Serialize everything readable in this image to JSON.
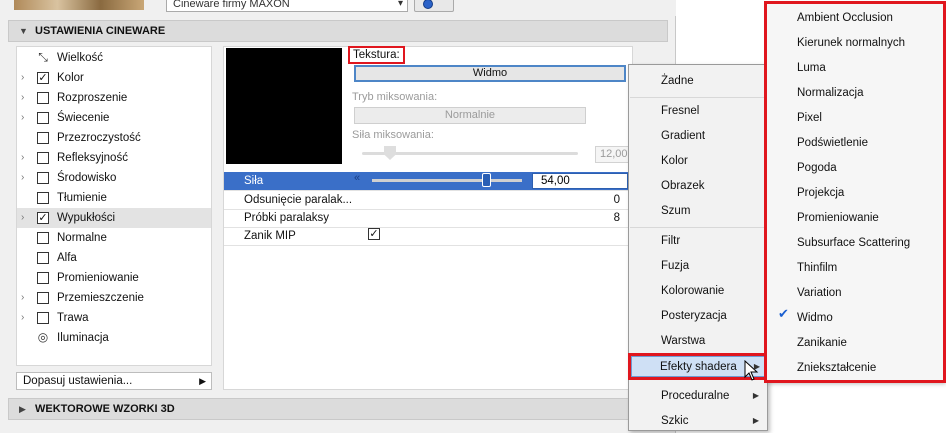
{
  "top": {
    "engine_value": "Cineware firmy MAXON"
  },
  "sections": {
    "cineware": "USTAWIENIA CINEWARE",
    "vector": "WEKTOROWE WZORKI 3D"
  },
  "channels": [
    {
      "label": "Wielkość",
      "kind": "icon",
      "checked": false,
      "arrow": false
    },
    {
      "label": "Kolor",
      "kind": "checkbox",
      "checked": true,
      "arrow": true
    },
    {
      "label": "Rozproszenie",
      "kind": "checkbox",
      "checked": false,
      "arrow": true
    },
    {
      "label": "Świecenie",
      "kind": "checkbox",
      "checked": false,
      "arrow": true
    },
    {
      "label": "Przezroczystość",
      "kind": "checkbox",
      "checked": false,
      "arrow": false
    },
    {
      "label": "Refleksyjność",
      "kind": "checkbox",
      "checked": false,
      "arrow": true
    },
    {
      "label": "Środowisko",
      "kind": "checkbox",
      "checked": false,
      "arrow": true
    },
    {
      "label": "Tłumienie",
      "kind": "checkbox",
      "checked": false,
      "arrow": false
    },
    {
      "label": "Wypukłości",
      "kind": "checkbox",
      "checked": true,
      "arrow": true,
      "selected": true
    },
    {
      "label": "Normalne",
      "kind": "checkbox",
      "checked": false,
      "arrow": false
    },
    {
      "label": "Alfa",
      "kind": "checkbox",
      "checked": false,
      "arrow": false
    },
    {
      "label": "Promieniowanie",
      "kind": "checkbox",
      "checked": false,
      "arrow": false
    },
    {
      "label": "Przemieszczenie",
      "kind": "checkbox",
      "checked": false,
      "arrow": true
    },
    {
      "label": "Trawa",
      "kind": "checkbox",
      "checked": false,
      "arrow": true
    },
    {
      "label": "Iluminacja",
      "kind": "icon",
      "checked": false,
      "arrow": false
    }
  ],
  "adjust_label": "Dopasuj ustawienia...",
  "texture": {
    "label": "Tekstura:",
    "value": "Widmo",
    "blend_mode_label": "Tryb miksowania:",
    "blend_mode_value": "Normalnie",
    "blend_strength_label": "Siła miksowania:",
    "blend_strength_value": "12,00"
  },
  "properties": [
    {
      "label": "Siła",
      "value": "54,00",
      "selected": true
    },
    {
      "label": "Odsunięcie paralak...",
      "value": "0"
    },
    {
      "label": "Próbki paralaksy",
      "value": "8"
    },
    {
      "label": "Zanik MIP",
      "value": "",
      "checkbox": true
    }
  ],
  "menu_main": [
    {
      "label": "Żadne",
      "sep_after": true
    },
    {
      "label": "Fresnel"
    },
    {
      "label": "Gradient"
    },
    {
      "label": "Kolor"
    },
    {
      "label": "Obrazek"
    },
    {
      "label": "Szum",
      "sep_after": true
    },
    {
      "label": "Filtr"
    },
    {
      "label": "Fuzja"
    },
    {
      "label": "Kolorowanie"
    },
    {
      "label": "Posteryzacja"
    },
    {
      "label": "Warstwa",
      "sep_after": true
    },
    {
      "label": "Efekty shadera",
      "submenu": true,
      "highlighted": true
    },
    {
      "label": "Proceduralne",
      "submenu": true
    },
    {
      "label": "Szkic",
      "submenu": true
    }
  ],
  "menu_shader": [
    {
      "label": "Ambient Occlusion"
    },
    {
      "label": "Kierunek normalnych"
    },
    {
      "label": "Luma"
    },
    {
      "label": "Normalizacja"
    },
    {
      "label": "Pixel"
    },
    {
      "label": "Podświetlenie"
    },
    {
      "label": "Pogoda"
    },
    {
      "label": "Projekcja"
    },
    {
      "label": "Promieniowanie"
    },
    {
      "label": "Subsurface Scattering"
    },
    {
      "label": "Thinfilm"
    },
    {
      "label": "Variation"
    },
    {
      "label": "Widmo",
      "checked": true
    },
    {
      "label": "Zanikanie"
    },
    {
      "label": "Zniekształcenie"
    }
  ],
  "colors": {
    "highlight_red": "#e0161e",
    "selection_blue": "#3a6fc8",
    "check_blue": "#1a5fd0"
  }
}
